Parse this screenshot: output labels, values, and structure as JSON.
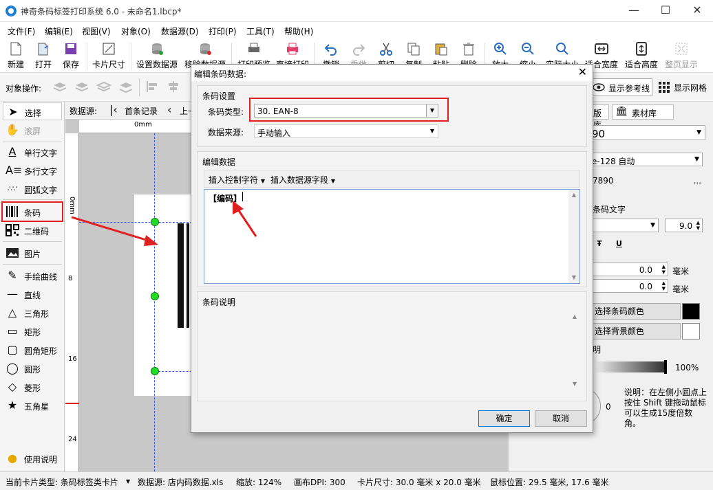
{
  "window": {
    "title": "神奇条码标签打印系统 6.0 - 未命名1.lbcp*",
    "minimize": "—",
    "maximize": "☐",
    "close": "✕"
  },
  "menu": [
    "文件(F)",
    "编辑(E)",
    "视图(V)",
    "对象(O)",
    "数据源(D)",
    "打印(P)",
    "工具(T)",
    "帮助(H)"
  ],
  "toolbar": {
    "new": "新建",
    "open": "打开",
    "save": "保存",
    "card_size": "卡片尺寸",
    "set_datasource": "设置数据源",
    "remove_datasource": "移除数据源",
    "print_preview": "打印预览",
    "direct_print": "直接打印",
    "undo": "撤销",
    "redo": "重做",
    "cut": "剪切",
    "copy": "复制",
    "paste": "粘贴",
    "delete": "删除",
    "zoom_in": "放大",
    "zoom_out": "缩小",
    "actual_size": "实际大小",
    "fit_width": "适合宽度",
    "fit_height": "适合高度",
    "page_display": "整页显示"
  },
  "object_bar": {
    "label": "对象操作:",
    "show_guides": "显示参考线",
    "show_grid": "显示网格"
  },
  "left_panel": {
    "select": "选择",
    "scroll": "滚屏",
    "single_text": "单行文字",
    "multi_text": "多行文字",
    "arc_text": "圆弧文字",
    "barcode": "条码",
    "qrcode": "二维码",
    "image": "图片",
    "freehand": "手绘曲线",
    "line": "直线",
    "triangle": "三角形",
    "rectangle": "矩形",
    "rounded_rect": "圆角矩形",
    "circle": "圆形",
    "diamond": "菱形",
    "star": "五角星",
    "help": "使用说明"
  },
  "canvas": {
    "datasource_label": "数据源:",
    "first_record": "首条记录",
    "prev_record": "上一",
    "ruler_h_zero": "0mm",
    "ruler_v": [
      "0mm",
      "8",
      "16",
      "24"
    ]
  },
  "right_panel": {
    "tabs": [
      "版库",
      "素材库"
    ],
    "value_90": "90",
    "encoding": "e-128 自动",
    "code": "7890",
    "ellipsis": "...",
    "barcode_text": "条码文字",
    "font_size": "9.0",
    "offset1": "0.0",
    "offset2": "0.0",
    "unit": "毫米",
    "bar_color": "选择条码颜色",
    "bg_color": "选择背景颜色",
    "transparency_label": "明",
    "transparency": "100%",
    "rotation": "0",
    "hint": "说明：在左侧小圆点上按住 Shift 键拖动鼠标可以生成15度倍数角。"
  },
  "status": {
    "card_type": "当前卡片类型: 条码标签类卡片",
    "datasource": "数据源: 店内码数据.xls",
    "zoom": "缩放: 124%",
    "dpi": "画布DPI: 300",
    "card_size": "卡片尺寸: 30.0 毫米 x 20.0 毫米",
    "mouse": "鼠标位置: 29.5 毫米, 17.6 毫米"
  },
  "dialog": {
    "title": "编辑条码数据:",
    "settings_group": "条码设置",
    "type_label": "条码类型:",
    "type_value": "30. EAN-8",
    "source_label": "数据来源:",
    "source_value": "手动输入",
    "edit_group": "编辑数据",
    "insert_control": "插入控制字符",
    "insert_field": "插入数据源字段",
    "data_text": "【编码】",
    "desc_group": "条码说明",
    "ok": "确定",
    "cancel": "取消"
  },
  "colors": {
    "accent_red": "#e02020",
    "handle_green": "#22dd22",
    "guide_blue": "#3355ff"
  }
}
